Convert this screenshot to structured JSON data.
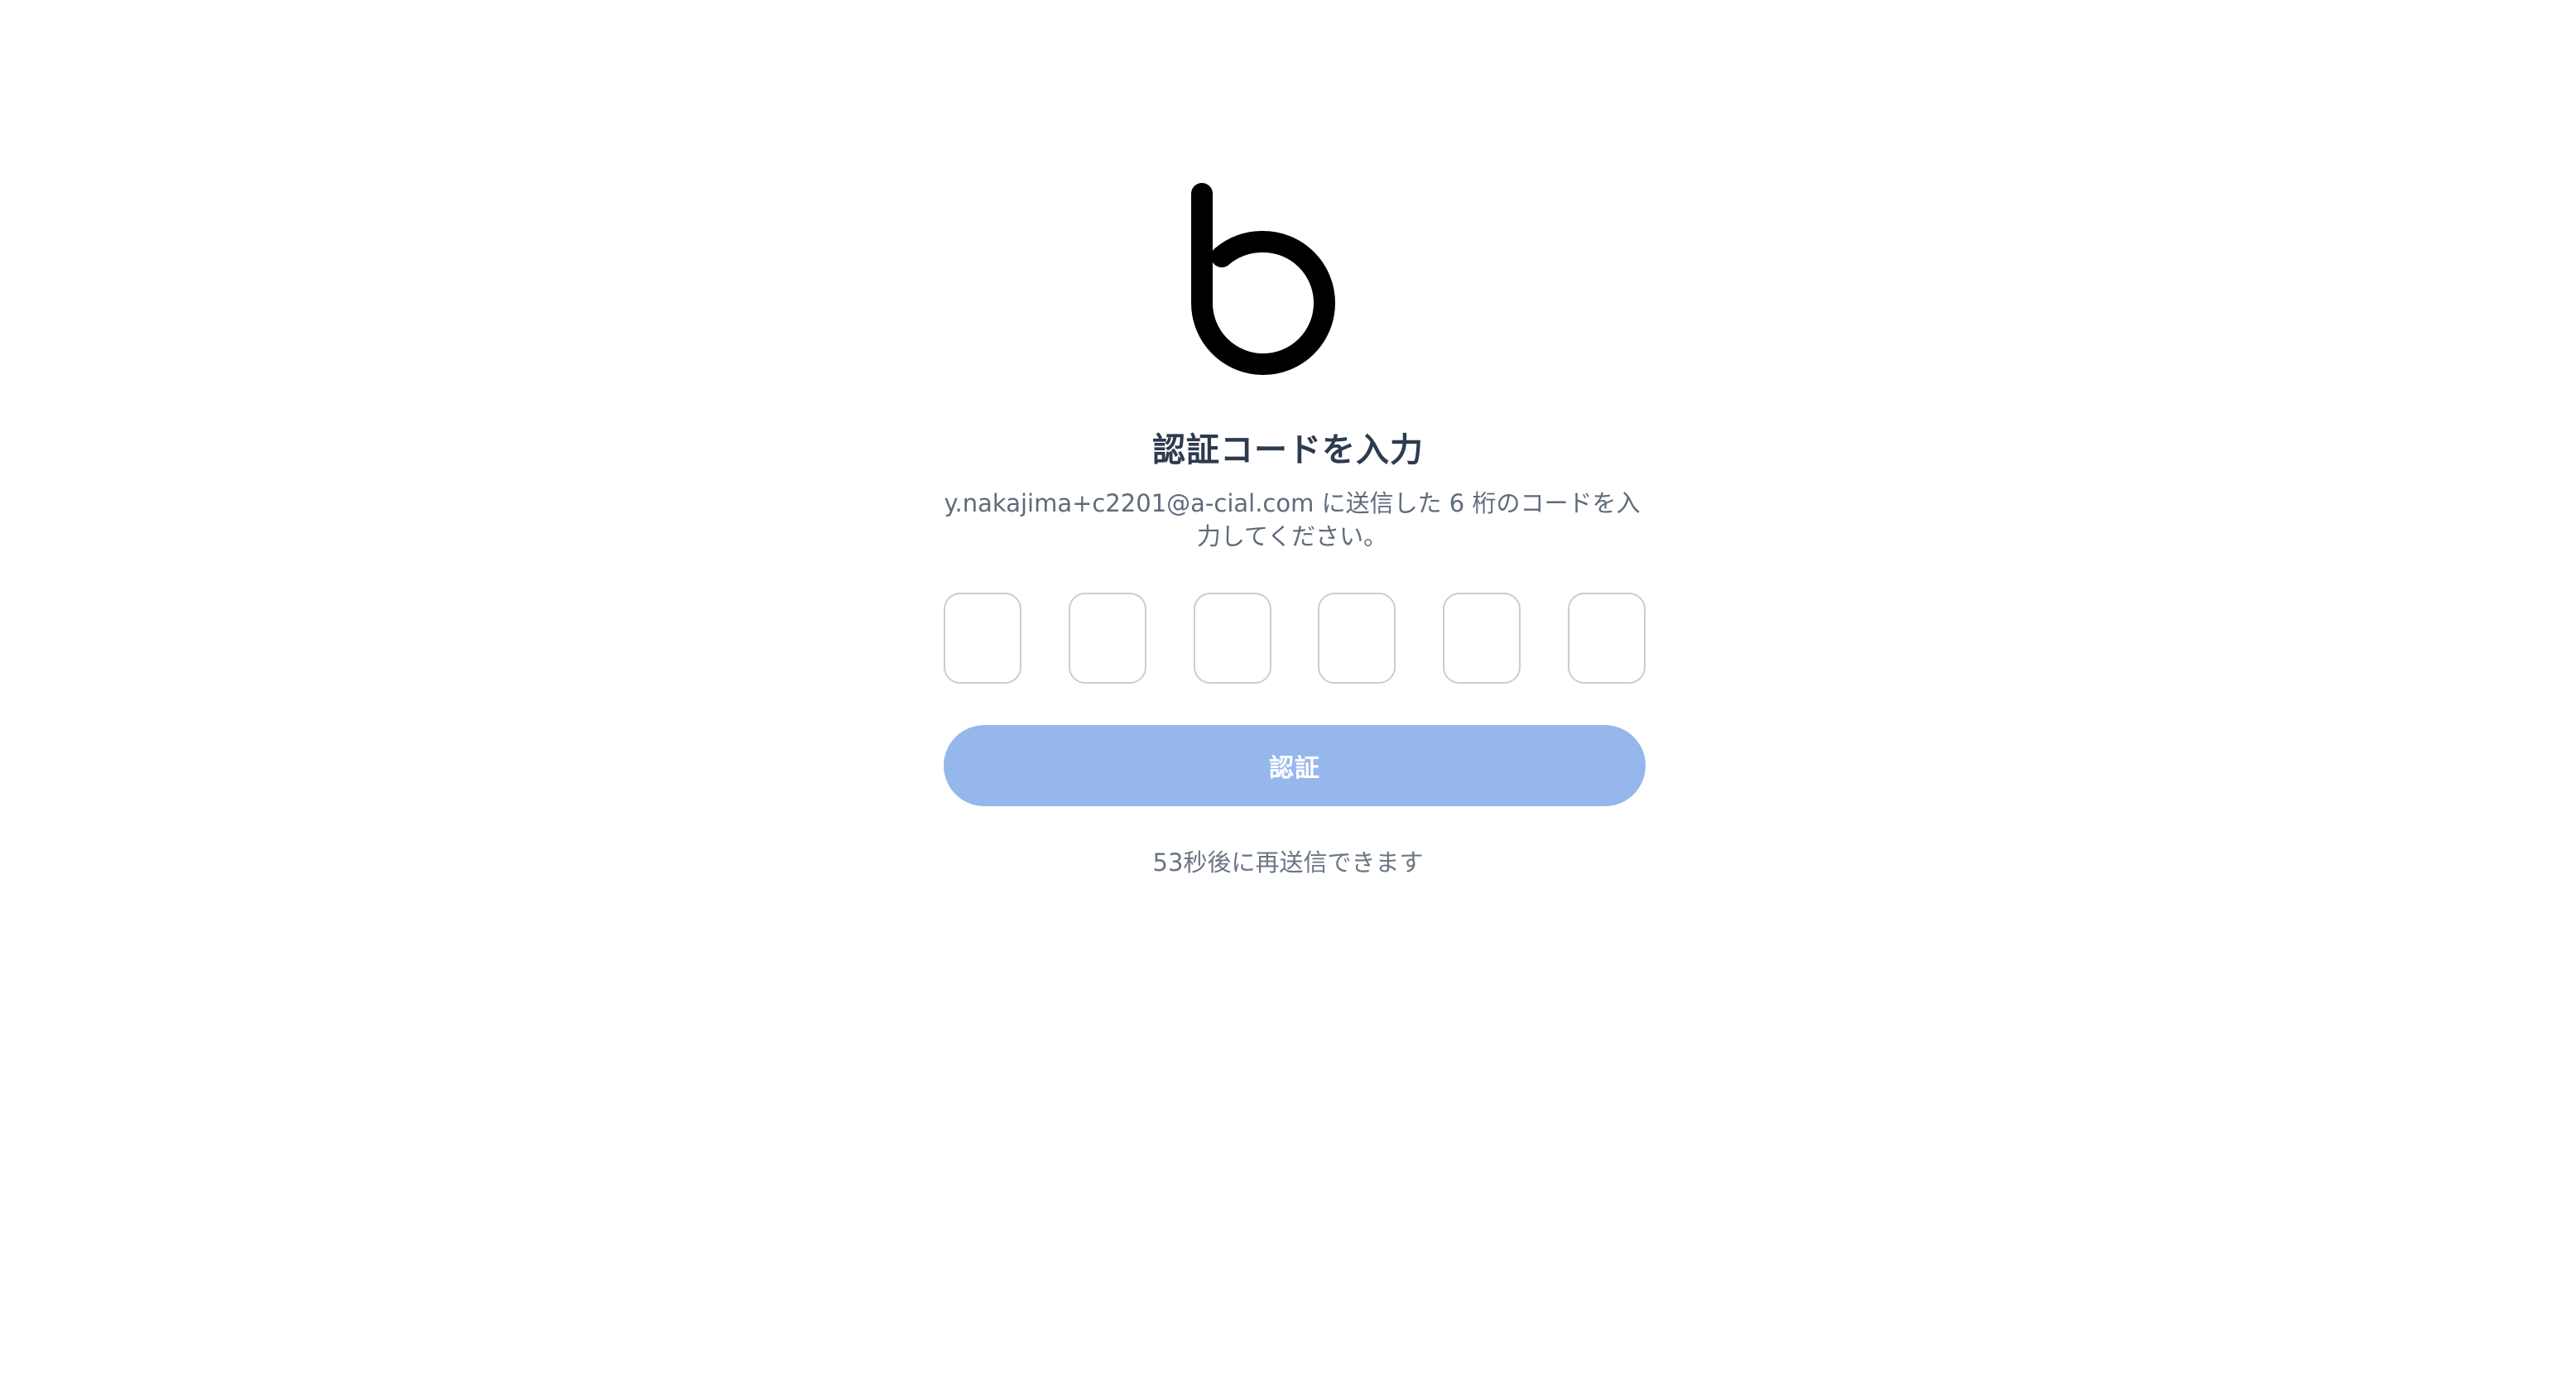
{
  "logo": {
    "icon": "b-plus-logo",
    "colors": {
      "letter": "#000000",
      "plus_start": "#1f8ff0",
      "plus_mid": "#6a1fd0",
      "plus_end": "#e8196b"
    }
  },
  "title": "認証コードを入力",
  "subtitle": "y.nakajima+c2201@a-cial.com に送信した 6 桁のコードを入力してください。",
  "code_inputs": [
    {
      "value": ""
    },
    {
      "value": ""
    },
    {
      "value": ""
    },
    {
      "value": ""
    },
    {
      "value": ""
    },
    {
      "value": ""
    }
  ],
  "verify_button": {
    "label": "認証",
    "color": "#96b7ec"
  },
  "resend_text": "53秒後に再送信できます"
}
